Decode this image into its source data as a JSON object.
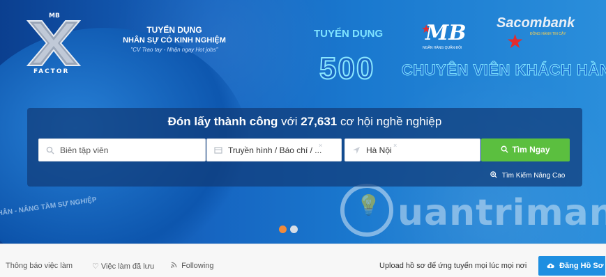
{
  "banner": {
    "logo": {
      "top_text": "MB",
      "bottom_text": "FACTOR"
    },
    "left_promo": {
      "line1": "TUYỂN DỤNG",
      "line2": "NHÂN SỰ CÓ KINH NGHIỆM",
      "line3": "\"CV Trao tay - Nhận ngay Hot jobs\""
    },
    "right_promo": {
      "title": "TUYỂN DỤNG",
      "number": "500",
      "subtitle": "CHUYÊN VIÊN KHÁCH HÀNG"
    },
    "mb_brand": {
      "logo_text": "MB",
      "sub_text": "NGÂN HÀNG QUÂN ĐỘI"
    },
    "sacombank": {
      "name": "Sacombank",
      "tagline": "ĐỒNG HÀNH TIN CẬY"
    },
    "ribbon_text": "NHÂN - NÂNG TẦM SỰ NGHIỆP",
    "watermark": "uantrimang"
  },
  "search": {
    "headline": {
      "strong": "Đón lấy thành công",
      "mid": " với ",
      "count": "27,631",
      "tail": " cơ hội nghề nghiệp"
    },
    "keyword_value": "Biên tập viên",
    "category_value": "Truyền hình / Báo chí / ...",
    "location_value": "Hà Nội",
    "button_label": "Tìm Ngay",
    "advanced_label": "Tìm Kiếm Nâng Cao"
  },
  "carousel": {
    "active_index": 0,
    "count": 2,
    "active_color": "#f08a3c",
    "inactive_color": "#d6dde6"
  },
  "bottom": {
    "links": [
      "Thông báo việc làm",
      "Việc làm đã lưu",
      "Following"
    ],
    "upload_text": "Upload hồ sơ để ứng tuyển mọi lúc mọi nơi",
    "upload_button": "Đăng Hồ Sơ"
  },
  "colors": {
    "accent_green": "#5bbf3f",
    "accent_blue": "#1e8fe1"
  }
}
